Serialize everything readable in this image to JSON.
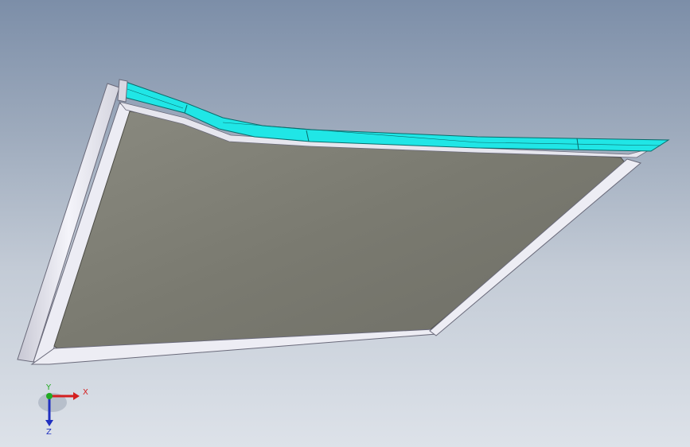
{
  "triad": {
    "x_label": "X",
    "y_label": "Y",
    "z_label": "Z",
    "x_color": "#d42020",
    "y_color": "#22aa22",
    "z_color": "#2030c0"
  },
  "colors": {
    "panel_face": "#7e7d71",
    "frame": "#e8e8f0",
    "selected_edge": "#20e6e6"
  }
}
